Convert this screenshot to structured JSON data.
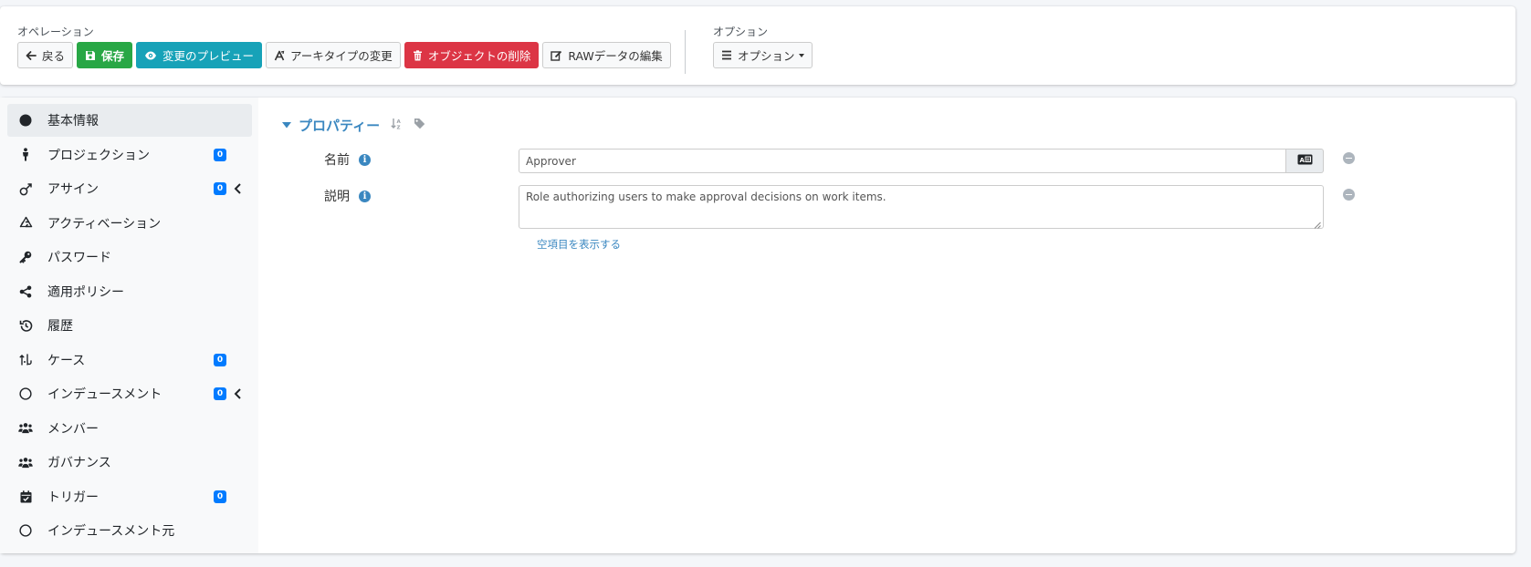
{
  "operations": {
    "label": "オペレーション",
    "back": "戻る",
    "save": "保存",
    "preview": "変更のプレビュー",
    "change_archetype": "アーキタイプの変更",
    "delete_object": "オブジェクトの削除",
    "edit_raw": "RAWデータの編集"
  },
  "options": {
    "label": "オプション",
    "button": "オプション"
  },
  "sidebar": {
    "items": [
      {
        "label": "基本情報",
        "icon": "circle-filled-icon"
      },
      {
        "label": "プロジェクション",
        "icon": "person-icon",
        "badge": "0"
      },
      {
        "label": "アサイン",
        "icon": "assignment-icon",
        "badge": "0"
      },
      {
        "label": "アクティベーション",
        "icon": "recycle-icon"
      },
      {
        "label": "パスワード",
        "icon": "key-icon"
      },
      {
        "label": "適用ポリシー",
        "icon": "share-icon"
      },
      {
        "label": "履歴",
        "icon": "history-icon"
      },
      {
        "label": "ケース",
        "icon": "case-icon",
        "badge": "0"
      },
      {
        "label": "インデュースメント",
        "icon": "circle-outline-icon",
        "badge": "0"
      },
      {
        "label": "メンバー",
        "icon": "users-icon"
      },
      {
        "label": "ガバナンス",
        "icon": "users-icon"
      },
      {
        "label": "トリガー",
        "icon": "calendar-check-icon",
        "badge": "0"
      },
      {
        "label": "インデュースメント元",
        "icon": "circle-outline-icon"
      }
    ]
  },
  "properties": {
    "title": "プロパティー",
    "name_label": "名前",
    "name_value": "Approver",
    "description_label": "説明",
    "description_value": "Role authorizing users to make approval decisions on work items.",
    "show_empty": "空項目を表示する"
  },
  "colors": {
    "success": "#28a745",
    "info": "#17a2b8",
    "danger": "#dc3545",
    "badge": "#007bff",
    "link": "#3a87c0"
  }
}
